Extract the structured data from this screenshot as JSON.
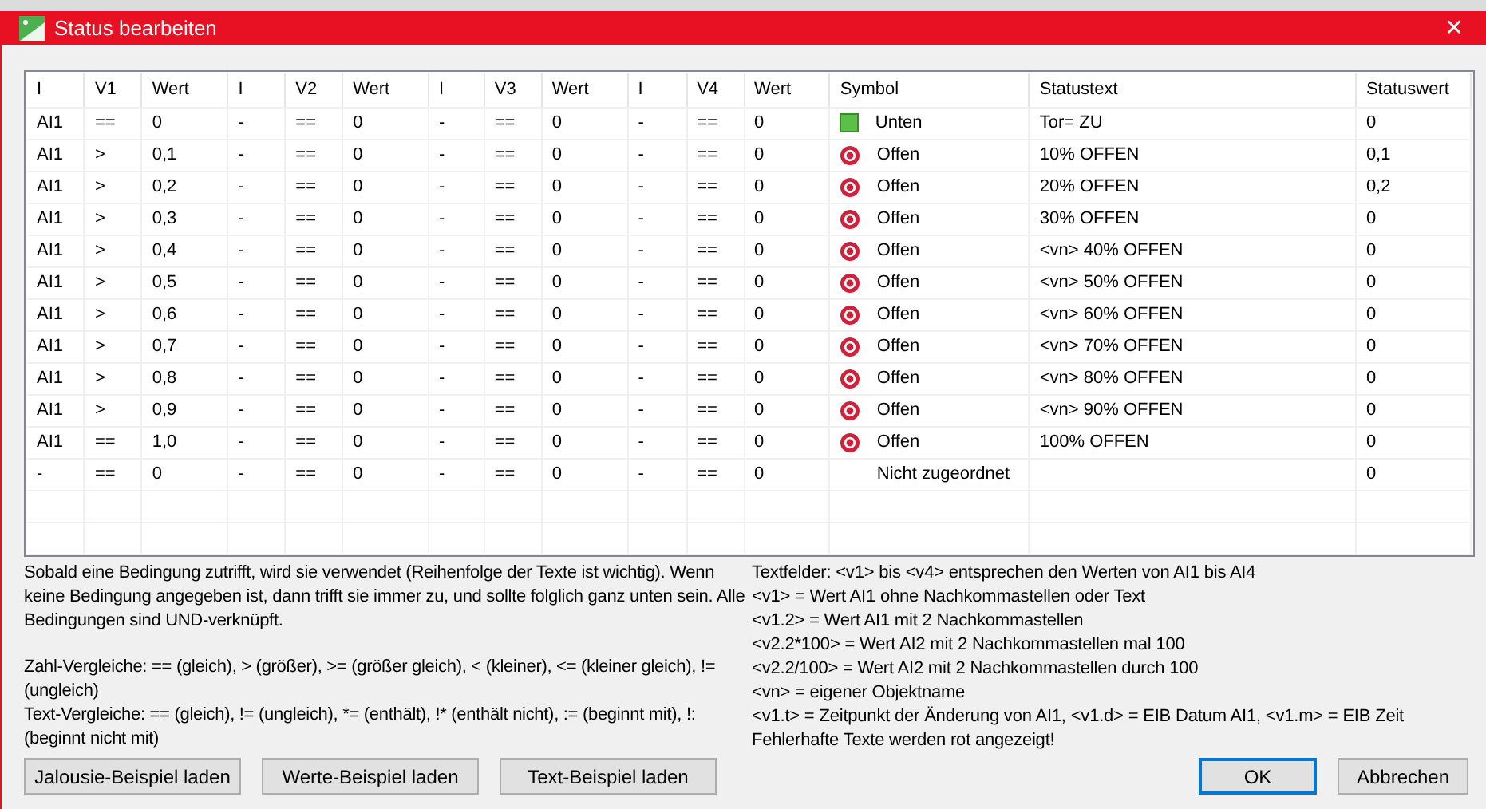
{
  "window": {
    "title": "Status bearbeiten",
    "close": "✕"
  },
  "table": {
    "columns": [
      "I",
      "V1",
      "Wert",
      "I",
      "V2",
      "Wert",
      "I",
      "V3",
      "Wert",
      "I",
      "V4",
      "Wert",
      "Symbol",
      "Statustext",
      "Statuswert"
    ],
    "rows": [
      {
        "cells": [
          "AI1",
          "==",
          "0",
          "-",
          "==",
          "0",
          "-",
          "==",
          "0",
          "-",
          "==",
          "0"
        ],
        "symbol": {
          "kind": "green-square",
          "label": "Unten"
        },
        "statustext": "Tor= ZU",
        "statuswert": "0"
      },
      {
        "cells": [
          "AI1",
          ">",
          "0,1",
          "-",
          "==",
          "0",
          "-",
          "==",
          "0",
          "-",
          "==",
          "0"
        ],
        "symbol": {
          "kind": "red-circle",
          "label": "Offen"
        },
        "statustext": "10% OFFEN",
        "statuswert": "0,1"
      },
      {
        "cells": [
          "AI1",
          ">",
          "0,2",
          "-",
          "==",
          "0",
          "-",
          "==",
          "0",
          "-",
          "==",
          "0"
        ],
        "symbol": {
          "kind": "red-circle",
          "label": "Offen"
        },
        "statustext": "20% OFFEN",
        "statuswert": "0,2"
      },
      {
        "cells": [
          "AI1",
          ">",
          "0,3",
          "-",
          "==",
          "0",
          "-",
          "==",
          "0",
          "-",
          "==",
          "0"
        ],
        "symbol": {
          "kind": "red-circle",
          "label": "Offen"
        },
        "statustext": "30% OFFEN",
        "statuswert": "0"
      },
      {
        "cells": [
          "AI1",
          ">",
          "0,4",
          "-",
          "==",
          "0",
          "-",
          "==",
          "0",
          "-",
          "==",
          "0"
        ],
        "symbol": {
          "kind": "red-circle",
          "label": "Offen"
        },
        "statustext": "<vn> 40% OFFEN",
        "statuswert": "0"
      },
      {
        "cells": [
          "AI1",
          ">",
          "0,5",
          "-",
          "==",
          "0",
          "-",
          "==",
          "0",
          "-",
          "==",
          "0"
        ],
        "symbol": {
          "kind": "red-circle",
          "label": "Offen"
        },
        "statustext": "<vn> 50% OFFEN",
        "statuswert": "0"
      },
      {
        "cells": [
          "AI1",
          ">",
          "0,6",
          "-",
          "==",
          "0",
          "-",
          "==",
          "0",
          "-",
          "==",
          "0"
        ],
        "symbol": {
          "kind": "red-circle",
          "label": "Offen"
        },
        "statustext": "<vn> 60% OFFEN",
        "statuswert": "0"
      },
      {
        "cells": [
          "AI1",
          ">",
          "0,7",
          "-",
          "==",
          "0",
          "-",
          "==",
          "0",
          "-",
          "==",
          "0"
        ],
        "symbol": {
          "kind": "red-circle",
          "label": "Offen"
        },
        "statustext": "<vn> 70% OFFEN",
        "statuswert": "0"
      },
      {
        "cells": [
          "AI1",
          ">",
          "0,8",
          "-",
          "==",
          "0",
          "-",
          "==",
          "0",
          "-",
          "==",
          "0"
        ],
        "symbol": {
          "kind": "red-circle",
          "label": "Offen"
        },
        "statustext": "<vn> 80% OFFEN",
        "statuswert": "0"
      },
      {
        "cells": [
          "AI1",
          ">",
          "0,9",
          "-",
          "==",
          "0",
          "-",
          "==",
          "0",
          "-",
          "==",
          "0"
        ],
        "symbol": {
          "kind": "red-circle",
          "label": "Offen"
        },
        "statustext": "<vn> 90% OFFEN",
        "statuswert": "0"
      },
      {
        "cells": [
          "AI1",
          "==",
          "1,0",
          "-",
          "==",
          "0",
          "-",
          "==",
          "0",
          "-",
          "==",
          "0"
        ],
        "symbol": {
          "kind": "red-circle",
          "label": "Offen"
        },
        "statustext": "100% OFFEN",
        "statuswert": "0"
      },
      {
        "cells": [
          "-",
          "==",
          "0",
          "-",
          "==",
          "0",
          "-",
          "==",
          "0",
          "-",
          "==",
          "0"
        ],
        "symbol": {
          "kind": "none",
          "label": "Nicht zugeordnet"
        },
        "statuswert": "0"
      }
    ]
  },
  "help_left": [
    "Sobald eine Bedingung zutrifft, wird sie verwendet (Reihenfolge der Texte ist wichtig). Wenn keine Bedingung angegeben ist, dann trifft sie immer zu, und sollte folglich ganz unten sein. Alle Bedingungen sind UND-verknüpft.",
    "Zahl-Vergleiche: == (gleich), > (größer), >= (größer gleich), < (kleiner), <= (kleiner gleich), != (ungleich)",
    "Text-Vergleiche: == (gleich), != (ungleich), *= (enthält), !* (enthält nicht), := (beginnt mit), !: (beginnt nicht mit)"
  ],
  "help_right": [
    "Textfelder: <v1> bis <v4> entsprechen den Werten von AI1 bis AI4",
    "<v1> = Wert AI1 ohne Nachkommastellen oder Text",
    "<v1.2> = Wert AI1 mit 2 Nachkommastellen",
    "<v2.2*100> = Wert AI2 mit 2 Nachkommastellen mal 100",
    "<v2.2/100> = Wert AI2 mit 2 Nachkommastellen durch 100",
    "<vn> = eigener Objektname",
    "<v1.t> = Zeitpunkt der Änderung von AI1, <v1.d> = EIB Datum AI1, <v1.m> = EIB Zeit",
    "Fehlerhafte Texte werden rot angezeigt!"
  ],
  "buttons_left": [
    "Jalousie-Beispiel laden",
    "Werte-Beispiel laden",
    "Text-Beispiel laden"
  ],
  "ok_button": "OK",
  "cancel_button": "Abbrechen"
}
